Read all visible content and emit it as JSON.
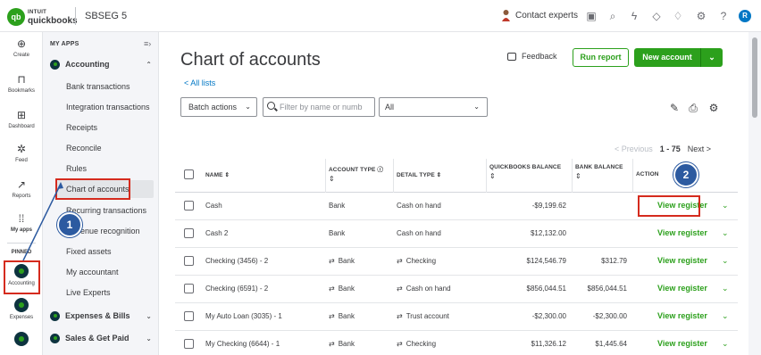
{
  "topbar": {
    "logo_badge": "qb",
    "logo_line1": "INTUIT",
    "logo_line2": "quickbooks",
    "company": "SBSEG 5",
    "contact_label": "Contact experts",
    "avatar_letter": "R"
  },
  "rail": {
    "items": [
      {
        "label": "Create",
        "icon": "plus-circle-icon"
      },
      {
        "label": "Bookmarks",
        "icon": "bookmark-icon"
      },
      {
        "label": "Dashboard",
        "icon": "dashboard-icon"
      },
      {
        "label": "Feed",
        "icon": "sparkle-icon"
      },
      {
        "label": "Reports",
        "icon": "chart-line-icon"
      },
      {
        "label": "My apps",
        "icon": "grid-icon"
      }
    ],
    "pinned_label": "PINNED",
    "accounting_label": "Accounting",
    "expenses_label": "Expenses"
  },
  "subnav": {
    "myapps_label": "MY APPS",
    "accounting_group": "Accounting",
    "links": [
      "Bank transactions",
      "Integration transactions",
      "Receipts",
      "Reconcile",
      "Rules",
      "Chart of accounts",
      "Recurring transactions",
      "Revenue recognition",
      "Fixed assets",
      "My accountant",
      "Live Experts"
    ],
    "expenses_group": "Expenses & Bills",
    "sales_group": "Sales & Get Paid"
  },
  "callouts": {
    "one": "1",
    "two": "2"
  },
  "main": {
    "title": "Chart of accounts",
    "all_lists": "< All lists",
    "feedback": "Feedback",
    "run_report": "Run report",
    "new_account": "New account",
    "batch_actions": "Batch actions",
    "filter_placeholder": "Filter by name or numb",
    "type_select": "All",
    "pager": {
      "prev": "< Previous",
      "count": "1 - 75",
      "next": "Next >"
    }
  },
  "table": {
    "headers": {
      "name": "NAME",
      "account_type": "ACCOUNT TYPE",
      "detail_type": "DETAIL TYPE",
      "qb_balance": "QUICKBOOKS BALANCE",
      "bank_balance": "BANK BALANCE",
      "action": "ACTION"
    },
    "rows": [
      {
        "name": "Cash",
        "type": "Bank",
        "detail": "Cash on hand",
        "qb": "-$9,199.62",
        "bank": "",
        "action": "View register",
        "bank_icon": false
      },
      {
        "name": "Cash 2",
        "type": "Bank",
        "detail": "Cash on hand",
        "qb": "$12,132.00",
        "bank": "",
        "action": "View register",
        "bank_icon": false
      },
      {
        "name": "Checking (3456) - 2",
        "type": "Bank",
        "detail": "Checking",
        "qb": "$124,546.79",
        "bank": "$312.79",
        "action": "View register",
        "bank_icon": true
      },
      {
        "name": "Checking (6591) - 2",
        "type": "Bank",
        "detail": "Cash on hand",
        "qb": "$856,044.51",
        "bank": "$856,044.51",
        "action": "View register",
        "bank_icon": true
      },
      {
        "name": "My Auto Loan (3035) - 1",
        "type": "Bank",
        "detail": "Trust account",
        "qb": "-$2,300.00",
        "bank": "-$2,300.00",
        "action": "View register",
        "bank_icon": true
      },
      {
        "name": "My Checking (6644) - 1",
        "type": "Bank",
        "detail": "Checking",
        "qb": "$11,326.12",
        "bank": "$1,445.64",
        "action": "View register",
        "bank_icon": true
      }
    ]
  },
  "colors": {
    "brand_green": "#2ca01c",
    "highlight_red": "#d52b1e",
    "callout_blue": "#2c5aa0",
    "link_blue": "#0077c5"
  }
}
